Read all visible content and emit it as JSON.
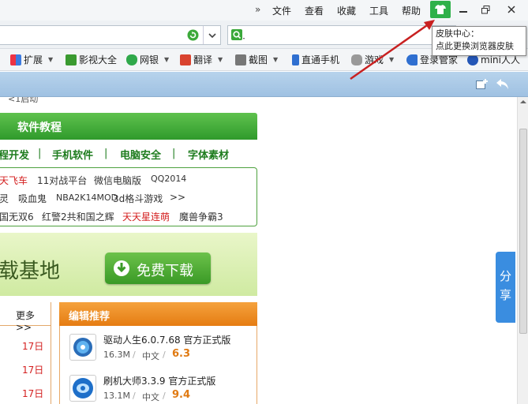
{
  "menubar": {
    "items": [
      "文件",
      "查看",
      "收藏",
      "工具",
      "帮助"
    ],
    "chevrons": "»"
  },
  "favorites_bar": {
    "items": [
      {
        "label": "扩展",
        "icon": "grid-icon",
        "color": "#3c7be0",
        "dropdown": true
      },
      {
        "label": "影视大全",
        "icon": "video-icon",
        "color": "#3a9a30",
        "dropdown": false
      },
      {
        "label": "网银",
        "icon": "shield-icon",
        "color": "#2fa84a",
        "dropdown": true
      },
      {
        "label": "翻译",
        "icon": "translate-icon",
        "color": "#d9432f",
        "dropdown": true
      },
      {
        "label": "截图",
        "icon": "scissors-icon",
        "color": "#555555",
        "dropdown": true
      },
      {
        "label": "直通手机",
        "icon": "phone-icon",
        "color": "#2f6fd0",
        "dropdown": false
      },
      {
        "label": "游戏",
        "icon": "gamepad-icon",
        "color": "#888888",
        "dropdown": true
      },
      {
        "label": "登录管家",
        "icon": "key-icon",
        "color": "#2f6fd0",
        "dropdown": false
      },
      {
        "label": "mini人人",
        "icon": "renren-icon",
        "color": "#2456b6",
        "dropdown": false
      }
    ]
  },
  "tooltip": {
    "title": "皮肤中心：",
    "text": "点此更换浏览器皮肤"
  },
  "page": {
    "top_snippet": "<1启动",
    "section_title": "软件教程",
    "categories": [
      "程开发",
      "手机软件",
      "电脑安全",
      "字体素材"
    ],
    "links": {
      "row1": [
        {
          "text": "天飞车",
          "red": true
        },
        {
          "text": "11对战平台",
          "red": false
        },
        {
          "text": "微信电脑版",
          "red": false
        },
        {
          "text": "QQ2014",
          "red": false
        }
      ],
      "row2": [
        {
          "text": "灵",
          "red": false
        },
        {
          "text": "吸血鬼",
          "red": false
        },
        {
          "text": "NBA2K14MOD",
          "red": false
        },
        {
          "text": "3d格斗游戏",
          "red": false
        },
        {
          "text": ">>",
          "red": false
        }
      ],
      "row3": [
        {
          "text": "国无双6",
          "red": false
        },
        {
          "text": "红警2共和国之辉",
          "red": false
        },
        {
          "text": "天天星连萌",
          "red": true
        },
        {
          "text": "魔兽争霸3",
          "red": false
        }
      ]
    },
    "banner_text": "载基地",
    "download_button": "免费下载",
    "more_link": "更多>>",
    "dates": [
      "17日",
      "17日",
      "17日"
    ],
    "editor_title": "编辑推荐",
    "apps": [
      {
        "name": "驱动人生6.0.7.68 官方正式版",
        "size": "16.3M",
        "lang": "中文",
        "score": "6.3"
      },
      {
        "name": "刷机大师3.3.9 官方正式版",
        "size": "13.1M",
        "lang": "中文",
        "score": "9.4"
      }
    ],
    "share": [
      "分",
      "享"
    ]
  }
}
